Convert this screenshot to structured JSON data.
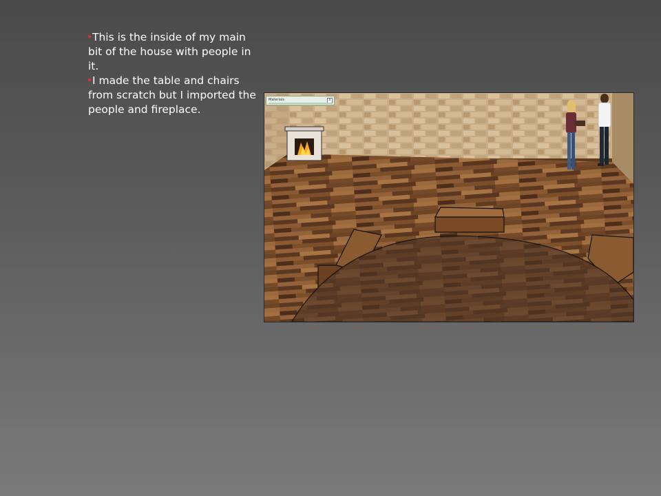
{
  "bullets": [
    "This is the inside of my main bit of the house with people in it.",
    "I made the table and chairs from scratch but I imported the people and fireplace."
  ],
  "scene": {
    "materials_panel_title": "Materials",
    "close_glyph": "x"
  },
  "colors": {
    "background_top": "#4a4a4a",
    "background_bottom": "#7a7a7a",
    "bullet_dot": "#e03030",
    "text": "#ffffff"
  }
}
